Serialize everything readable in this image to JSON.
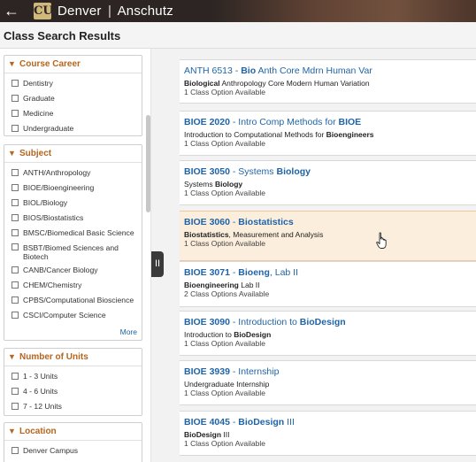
{
  "header": {
    "back_glyph": "←",
    "logo_glyph": "CU",
    "brand_left": "Denver",
    "brand_sep": "|",
    "brand_right": "Anschutz"
  },
  "page": {
    "title": "Class Search Results"
  },
  "filters": {
    "career": {
      "title": "Course Career",
      "options": [
        "Dentistry",
        "Graduate",
        "Medicine",
        "Undergraduate"
      ]
    },
    "subject": {
      "title": "Subject",
      "options": [
        "ANTH/Anthropology",
        "BIOE/Bioengineering",
        "BIOL/Biology",
        "BIOS/Biostatistics",
        "BMSC/Biomedical Basic Science",
        "BSBT/Biomed Sciences and Biotech",
        "CANB/Cancer Biology",
        "CHEM/Chemistry",
        "CPBS/Computational Bioscience",
        "CSCI/Computer Science"
      ],
      "more_label": "More"
    },
    "units": {
      "title": "Number of Units",
      "options": [
        "1 - 3 Units",
        "4 - 6 Units",
        "7 - 12 Units"
      ]
    },
    "location": {
      "title": "Location",
      "options": [
        "Denver Campus"
      ]
    }
  },
  "collapse_glyph": "II",
  "results": [
    {
      "code": "ANTH 6513",
      "sep": " - ",
      "title_pre": "",
      "title_hl": "Bio",
      "title_post": " Anth Core Mdrn Human Var",
      "desc_hl": "Biological",
      "desc_post": " Anthropology Core  Modern Human Variation",
      "options": "1 Class Option Available"
    },
    {
      "code": "BIOE 2020",
      "sep": " - ",
      "title_pre": "Intro Comp Methods for ",
      "title_hl": "BIOE",
      "title_post": "",
      "desc_pre": "Introduction to Computational Methods for ",
      "desc_hl": "Bioengineers",
      "options": "1 Class Option Available"
    },
    {
      "code": "BIOE 3050",
      "sep": " - ",
      "title_pre": "Systems ",
      "title_hl": "Biology",
      "title_post": "",
      "desc_pre": "Systems ",
      "desc_hl": "Biology",
      "options": "1 Class Option Available"
    },
    {
      "code": "BIOE 3060",
      "sep": " - ",
      "title_hl": "Biostatistics",
      "desc_hl": "Biostatistics",
      "desc_post": ", Measurement and Analysis",
      "options": "1 Class Option Available"
    },
    {
      "code": "BIOE 3071",
      "sep": " - ",
      "title_hl": "Bioeng",
      "title_post": ", Lab II",
      "desc_hl": "Bioengineering",
      "desc_post": " Lab II",
      "options": "2 Class Options Available"
    },
    {
      "code": "BIOE 3090",
      "sep": " - ",
      "title_pre": "Introduction to ",
      "title_hl": "BioDesign",
      "desc_pre": "Introduction to ",
      "desc_hl": "BioDesign",
      "options": "1 Class Option Available"
    },
    {
      "code": "BIOE 3939",
      "sep": " - ",
      "title_pre": "Internship",
      "desc_pre": "Undergraduate Internship",
      "options": "1 Class Option Available"
    },
    {
      "code": "BIOE 4045",
      "sep": " - ",
      "title_hl": "BioDesign",
      "title_post": " III",
      "desc_hl": "BioDesign",
      "desc_post": " III",
      "options": "1 Class Option Available"
    }
  ]
}
